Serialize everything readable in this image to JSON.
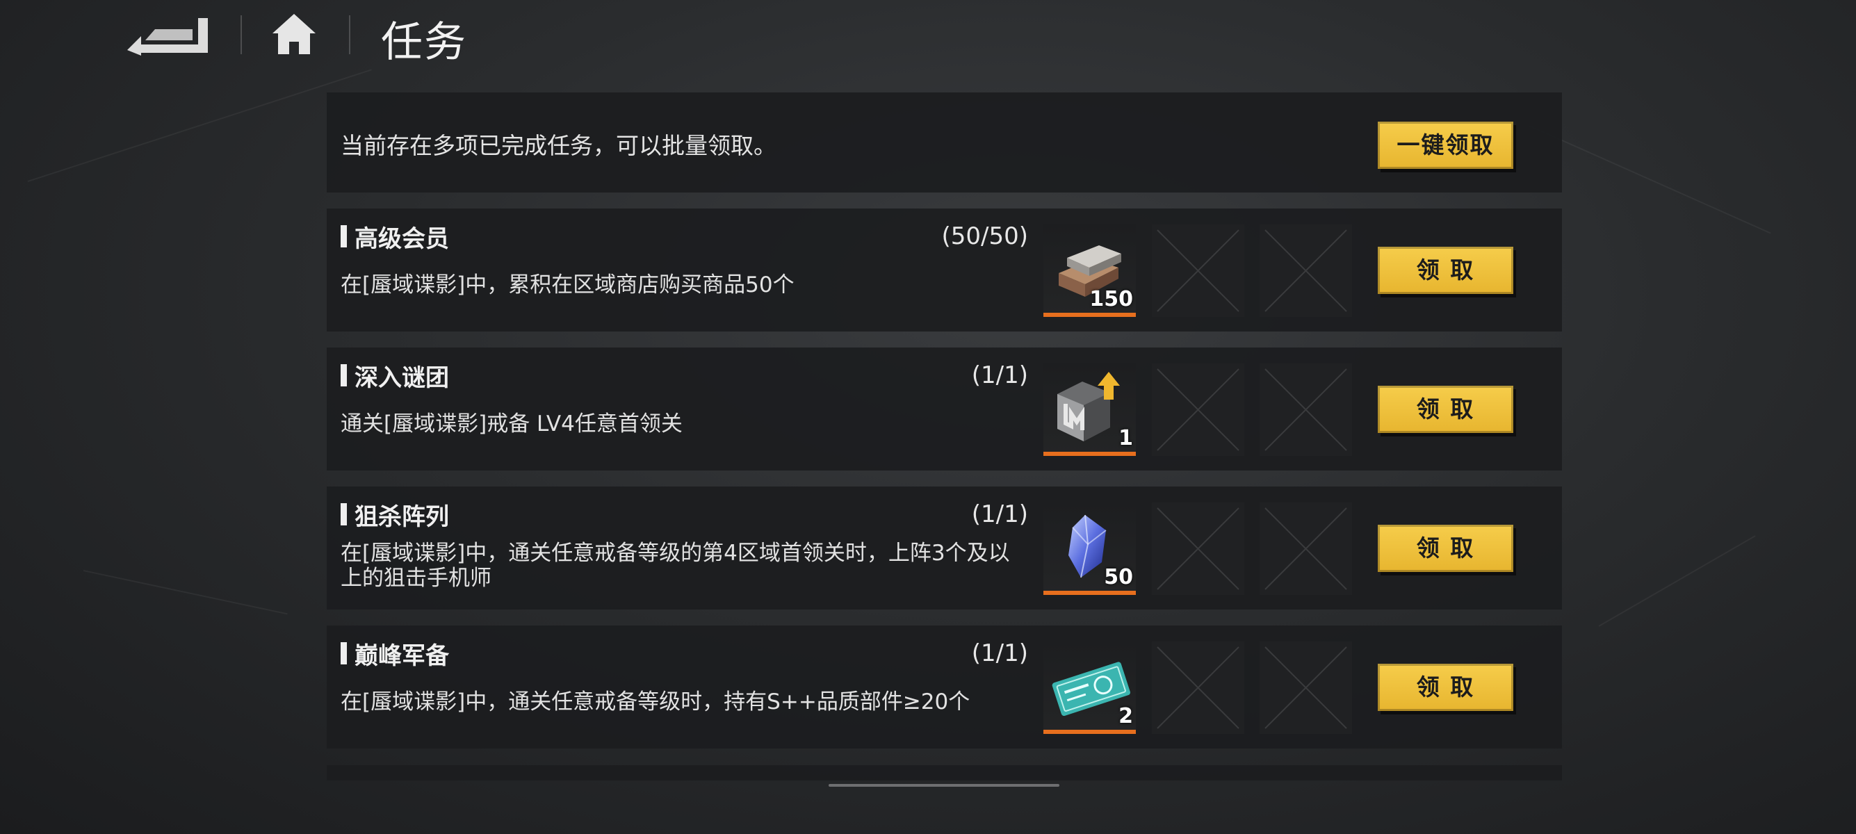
{
  "header": {
    "title": "任务"
  },
  "bulk": {
    "message": "当前存在多项已完成任务，可以批量领取。",
    "button_label": "一键领取"
  },
  "tasks": [
    {
      "title": "高级会员",
      "progress": "(50/50)",
      "description": "在[蜃域谍影]中，累积在区域商店购买商品50个",
      "reward_icon": "metal-ingot-icon",
      "reward_count": "150",
      "button_label": "领 取"
    },
    {
      "title": "深入谜团",
      "progress": "(1/1)",
      "description": "通关[蜃域谍影]戒备 LV4任意首领关",
      "reward_icon": "upgrade-module-icon",
      "reward_count": "1",
      "button_label": "领 取"
    },
    {
      "title": "狙杀阵列",
      "progress": "(1/1)",
      "description": "在[蜃域谍影]中，通关任意戒备等级的第4区域首领关时，上阵3个及以上的狙击手机师",
      "reward_icon": "blue-crystal-icon",
      "reward_count": "50",
      "button_label": "领 取"
    },
    {
      "title": "巅峰军备",
      "progress": "(1/1)",
      "description": "在[蜃域谍影]中，通关任意戒备等级时，持有S++品质部件≥20个",
      "reward_icon": "ticket-icon",
      "reward_count": "2",
      "button_label": "领 取"
    }
  ],
  "colors": {
    "accent_gold": "#f0c33e",
    "progress_orange": "#e76f1e"
  }
}
